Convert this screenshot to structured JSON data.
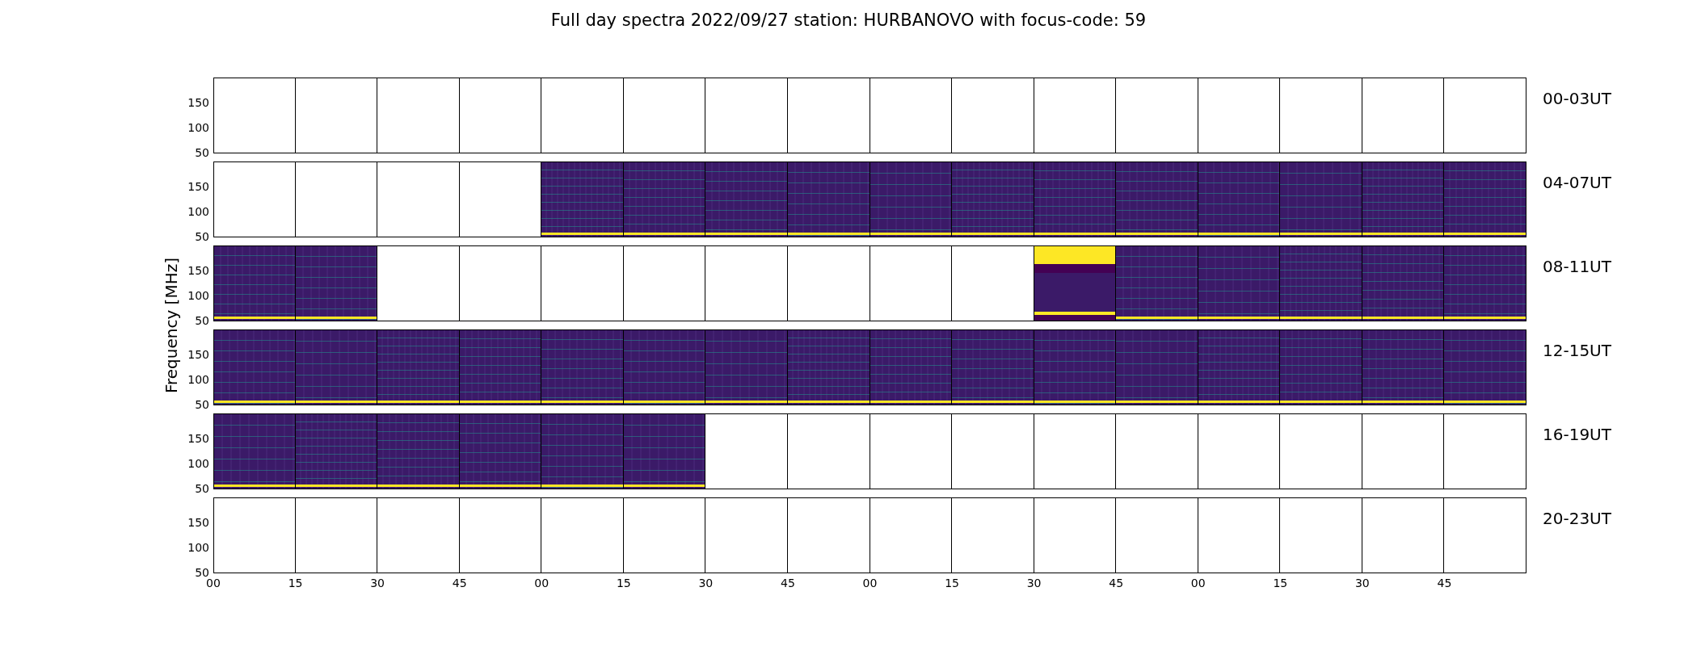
{
  "title": "Full day spectra 2022/09/27 station: HURBANOVO with focus-code: 59",
  "ylabel": "Frequency [MHz]",
  "xticks": [
    "00",
    "15",
    "30",
    "45",
    "00",
    "15",
    "30",
    "45",
    "00",
    "15",
    "30",
    "45",
    "00",
    "15",
    "30",
    "45"
  ],
  "rows": [
    {
      "label": "00-03UT",
      "yticks": [
        "150",
        "100",
        "50"
      ],
      "cells": [
        {
          "kind": "empty"
        },
        {
          "kind": "empty"
        },
        {
          "kind": "empty"
        },
        {
          "kind": "empty"
        },
        {
          "kind": "empty"
        },
        {
          "kind": "empty"
        },
        {
          "kind": "empty"
        },
        {
          "kind": "empty"
        },
        {
          "kind": "empty"
        },
        {
          "kind": "empty"
        },
        {
          "kind": "empty"
        },
        {
          "kind": "empty"
        },
        {
          "kind": "empty"
        },
        {
          "kind": "empty"
        },
        {
          "kind": "empty"
        },
        {
          "kind": "empty"
        }
      ]
    },
    {
      "label": "04-07UT",
      "yticks": [
        "150",
        "100",
        "50"
      ],
      "cells": [
        {
          "kind": "empty"
        },
        {
          "kind": "empty"
        },
        {
          "kind": "empty"
        },
        {
          "kind": "empty"
        },
        {
          "kind": "spectrum"
        },
        {
          "kind": "spectrum"
        },
        {
          "kind": "spectrum"
        },
        {
          "kind": "spectrum"
        },
        {
          "kind": "spectrum"
        },
        {
          "kind": "spectrum"
        },
        {
          "kind": "spectrum"
        },
        {
          "kind": "spectrum"
        },
        {
          "kind": "spectrum"
        },
        {
          "kind": "spectrum"
        },
        {
          "kind": "spectrum"
        },
        {
          "kind": "spectrum"
        }
      ]
    },
    {
      "label": "08-11UT",
      "yticks": [
        "150",
        "100",
        "50"
      ],
      "cells": [
        {
          "kind": "spectrum"
        },
        {
          "kind": "spectrum"
        },
        {
          "kind": "empty"
        },
        {
          "kind": "empty"
        },
        {
          "kind": "empty"
        },
        {
          "kind": "empty"
        },
        {
          "kind": "empty"
        },
        {
          "kind": "empty"
        },
        {
          "kind": "empty"
        },
        {
          "kind": "empty"
        },
        {
          "kind": "burst"
        },
        {
          "kind": "spectrum"
        },
        {
          "kind": "spectrum"
        },
        {
          "kind": "spectrum"
        },
        {
          "kind": "spectrum"
        },
        {
          "kind": "spectrum"
        }
      ]
    },
    {
      "label": "12-15UT",
      "yticks": [
        "150",
        "100",
        "50"
      ],
      "cells": [
        {
          "kind": "spectrum"
        },
        {
          "kind": "spectrum"
        },
        {
          "kind": "spectrum"
        },
        {
          "kind": "spectrum"
        },
        {
          "kind": "spectrum"
        },
        {
          "kind": "spectrum"
        },
        {
          "kind": "spectrum"
        },
        {
          "kind": "spectrum"
        },
        {
          "kind": "spectrum"
        },
        {
          "kind": "spectrum"
        },
        {
          "kind": "spectrum"
        },
        {
          "kind": "spectrum"
        },
        {
          "kind": "spectrum"
        },
        {
          "kind": "spectrum"
        },
        {
          "kind": "spectrum"
        },
        {
          "kind": "spectrum"
        }
      ]
    },
    {
      "label": "16-19UT",
      "yticks": [
        "150",
        "100",
        "50"
      ],
      "cells": [
        {
          "kind": "spectrum"
        },
        {
          "kind": "spectrum"
        },
        {
          "kind": "spectrum"
        },
        {
          "kind": "spectrum"
        },
        {
          "kind": "spectrum"
        },
        {
          "kind": "spectrum"
        },
        {
          "kind": "empty"
        },
        {
          "kind": "empty"
        },
        {
          "kind": "empty"
        },
        {
          "kind": "empty"
        },
        {
          "kind": "empty"
        },
        {
          "kind": "empty"
        },
        {
          "kind": "empty"
        },
        {
          "kind": "empty"
        },
        {
          "kind": "empty"
        },
        {
          "kind": "empty"
        }
      ]
    },
    {
      "label": "20-23UT",
      "yticks": [
        "150",
        "100",
        "50"
      ],
      "cells": [
        {
          "kind": "empty"
        },
        {
          "kind": "empty"
        },
        {
          "kind": "empty"
        },
        {
          "kind": "empty"
        },
        {
          "kind": "empty"
        },
        {
          "kind": "empty"
        },
        {
          "kind": "empty"
        },
        {
          "kind": "empty"
        },
        {
          "kind": "empty"
        },
        {
          "kind": "empty"
        },
        {
          "kind": "empty"
        },
        {
          "kind": "empty"
        },
        {
          "kind": "empty"
        },
        {
          "kind": "empty"
        },
        {
          "kind": "empty"
        },
        {
          "kind": "empty"
        }
      ]
    }
  ]
}
